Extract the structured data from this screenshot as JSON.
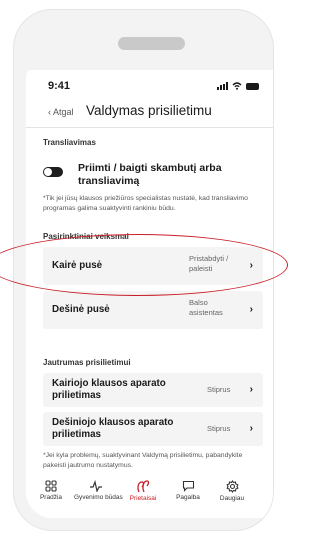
{
  "status": {
    "time": "9:41"
  },
  "nav": {
    "back_label": "Atgal",
    "title": "Valdymas prisilietimu"
  },
  "broadcast": {
    "section_label": "Transliavimas",
    "toggle_label": "Priimti / baigti skambutį arba transliavimą",
    "note": "*Tik jei jūsų klausos priežiūros specialistas nustatė, kad transliavimo programas galima suaktyvinti rankiniu būdu."
  },
  "actions": {
    "section_label": "Pasirinktiniai veiksmai",
    "items": [
      {
        "title": "Kairė pusė",
        "value": "Pristabdyti / paleisti"
      },
      {
        "title": "Dešinė pusė",
        "value": "Balso asistentas"
      }
    ]
  },
  "sensitivity": {
    "section_label": "Jautrumas prisilietimui",
    "items": [
      {
        "title": "Kairiojo klausos aparato prilietimas",
        "value": "Stiprus"
      },
      {
        "title": "Dešiniojo klausos aparato prilietimas",
        "value": "Stiprus"
      }
    ],
    "note": "*Jei kyla problemų, suaktyvinant Valdymą prisilietimu, pabandykite pakeisti jautrumo nustatymus."
  },
  "tabbar": {
    "items": [
      {
        "label": "Pradžia",
        "icon": "grid-icon"
      },
      {
        "label": "Gyvenimo būdas",
        "icon": "activity-icon"
      },
      {
        "label": "Prietaisai",
        "icon": "hearing-aids-icon"
      },
      {
        "label": "Pagalba",
        "icon": "chat-icon"
      },
      {
        "label": "Daugiau",
        "icon": "gear-icon"
      }
    ],
    "active_index": 2
  },
  "colors": {
    "accent": "#c92028",
    "annotation": "#c92028"
  }
}
